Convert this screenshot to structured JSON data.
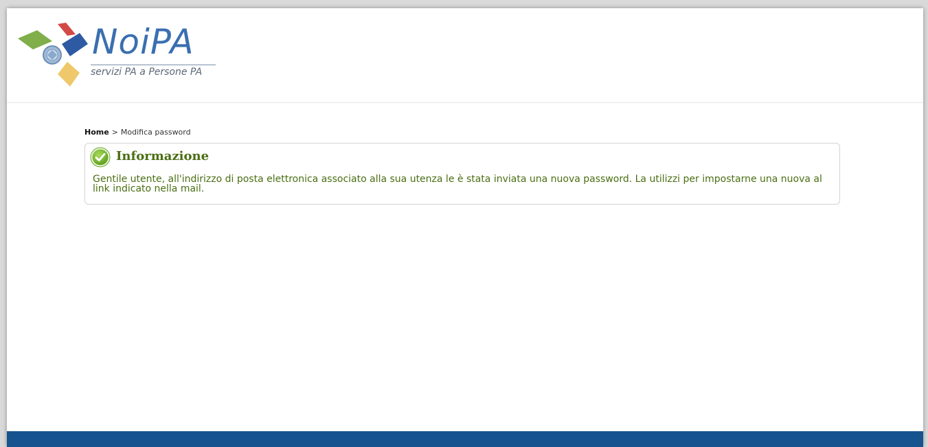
{
  "header": {
    "logo": {
      "wordmark": "NoiPA",
      "tagline": "servizi PA a Persone PA"
    }
  },
  "breadcrumb": {
    "home_label": "Home",
    "separator": ">",
    "current_label": "Modifica password"
  },
  "message": {
    "type": "success",
    "icon": "check-circle-icon",
    "title": "Informazione",
    "text": "Gentile utente, all'indirizzo di posta elettronica associato alla sua utenza le è stata inviata una nuova password. La utilizzi per impostarne una nuova al link indicato nella mail."
  },
  "colors": {
    "brand_blue": "#3a6fb0",
    "footer_blue": "#17538f",
    "message_green": "#4a6e12",
    "icon_green": "#7cbf2f"
  }
}
